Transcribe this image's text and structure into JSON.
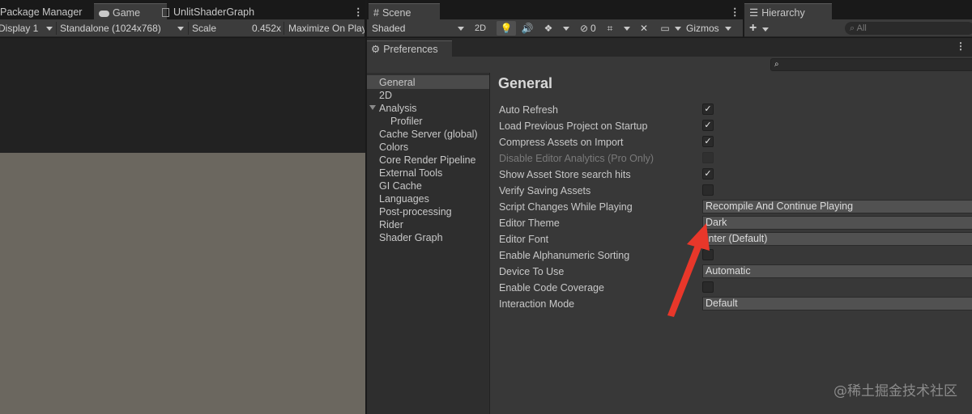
{
  "left_tabs": {
    "package_manager": "Package Manager",
    "game": "Game",
    "unlit_shader_graph": "UnlitShaderGraph"
  },
  "game_toolbar": {
    "display": "Display 1",
    "resolution": "Standalone (1024x768)",
    "scale_label": "Scale",
    "scale_value": "0.452x",
    "maximize": "Maximize On Play"
  },
  "scene_tab": "Scene",
  "scene_toolbar": {
    "shading": "Shaded",
    "btn_2d": "2D",
    "hidden_count": "0",
    "gizmos": "Gizmos"
  },
  "hierarchy": {
    "tab": "Hierarchy",
    "add": "+",
    "search_placeholder": "All"
  },
  "preferences": {
    "tab": "Preferences",
    "search_value": "",
    "sidebar": [
      {
        "label": "General",
        "selected": true
      },
      {
        "label": "2D"
      },
      {
        "label": "Analysis",
        "expanded": true
      },
      {
        "label": "Profiler",
        "indent": true
      },
      {
        "label": "Cache Server (global)"
      },
      {
        "label": "Colors"
      },
      {
        "label": "Core Render Pipeline"
      },
      {
        "label": "External Tools"
      },
      {
        "label": "GI Cache"
      },
      {
        "label": "Languages"
      },
      {
        "label": "Post-processing"
      },
      {
        "label": "Rider"
      },
      {
        "label": "Shader Graph"
      }
    ],
    "heading": "General",
    "rows": [
      {
        "label": "Auto Refresh",
        "type": "checkbox",
        "checked": true
      },
      {
        "label": "Load Previous Project on Startup",
        "type": "checkbox",
        "checked": true
      },
      {
        "label": "Compress Assets on Import",
        "type": "checkbox",
        "checked": true
      },
      {
        "label": "Disable Editor Analytics (Pro Only)",
        "type": "checkbox",
        "checked": false,
        "disabled": true
      },
      {
        "label": "Show Asset Store search hits",
        "type": "checkbox",
        "checked": true
      },
      {
        "label": "Verify Saving Assets",
        "type": "checkbox",
        "checked": false
      },
      {
        "label": "Script Changes While Playing",
        "type": "dropdown",
        "value": "Recompile And Continue Playing"
      },
      {
        "label": "Editor Theme",
        "type": "dropdown",
        "value": "Dark"
      },
      {
        "label": "Editor Font",
        "type": "dropdown",
        "value": "Inter (Default)"
      },
      {
        "label": "Enable Alphanumeric Sorting",
        "type": "checkbox",
        "checked": false
      },
      {
        "label": "Device To Use",
        "type": "dropdown",
        "value": "Automatic"
      },
      {
        "label": "Enable Code Coverage",
        "type": "checkbox",
        "checked": false
      },
      {
        "label": "Interaction Mode",
        "type": "dropdown",
        "value": "Default"
      }
    ]
  },
  "colors": {
    "annotation_arrow": "#e8372a",
    "selected_item": "#4a4a4a",
    "panel_bg": "#383838",
    "sidebar_bg": "#2e2e2e",
    "game_view_bg": "#6b675f"
  },
  "watermark": "@稀土掘金技术社区"
}
